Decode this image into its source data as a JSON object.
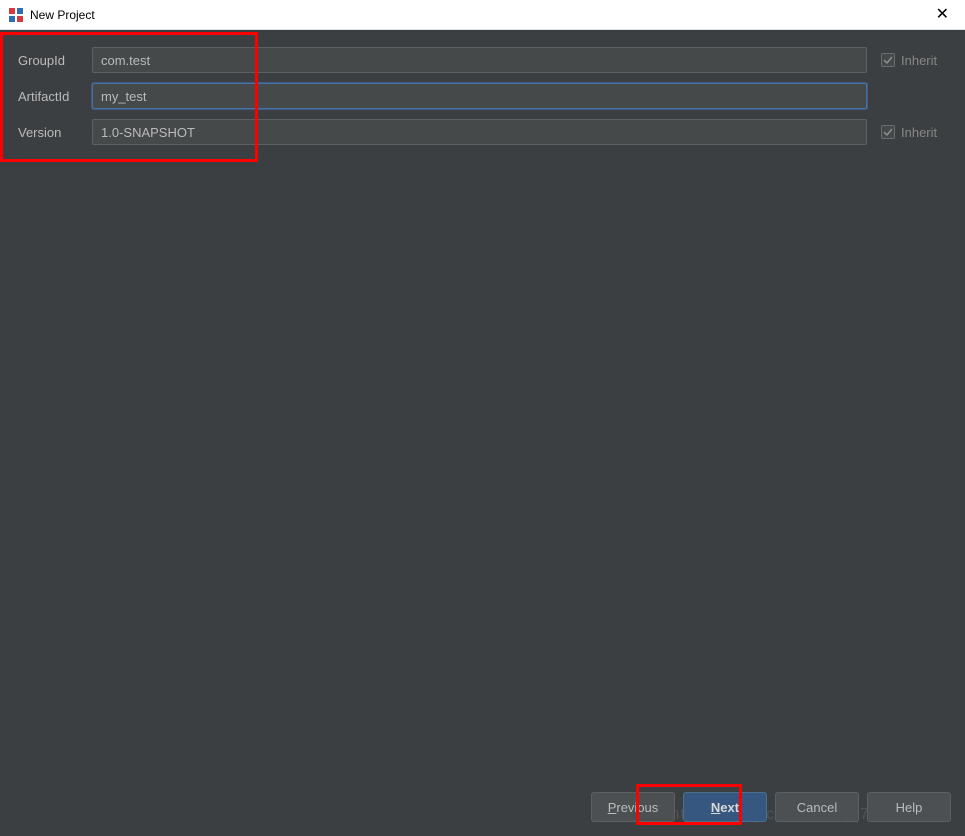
{
  "titlebar": {
    "title": "New Project"
  },
  "form": {
    "groupId": {
      "label": "GroupId",
      "value": "com.test",
      "inherit_label": "Inherit",
      "inherit_checked": true
    },
    "artifactId": {
      "label": "ArtifactId",
      "value": "my_test"
    },
    "version": {
      "label": "Version",
      "value": "1.0-SNAPSHOT",
      "inherit_label": "Inherit",
      "inherit_checked": true
    }
  },
  "buttons": {
    "previous": {
      "mnemonic": "P",
      "rest": "revious"
    },
    "next": {
      "mnemonic": "N",
      "rest": "ext"
    },
    "cancel": {
      "label": "Cancel"
    },
    "help": {
      "label": "Help"
    }
  },
  "watermark": "https://blog.csdn.net/qq784515681"
}
